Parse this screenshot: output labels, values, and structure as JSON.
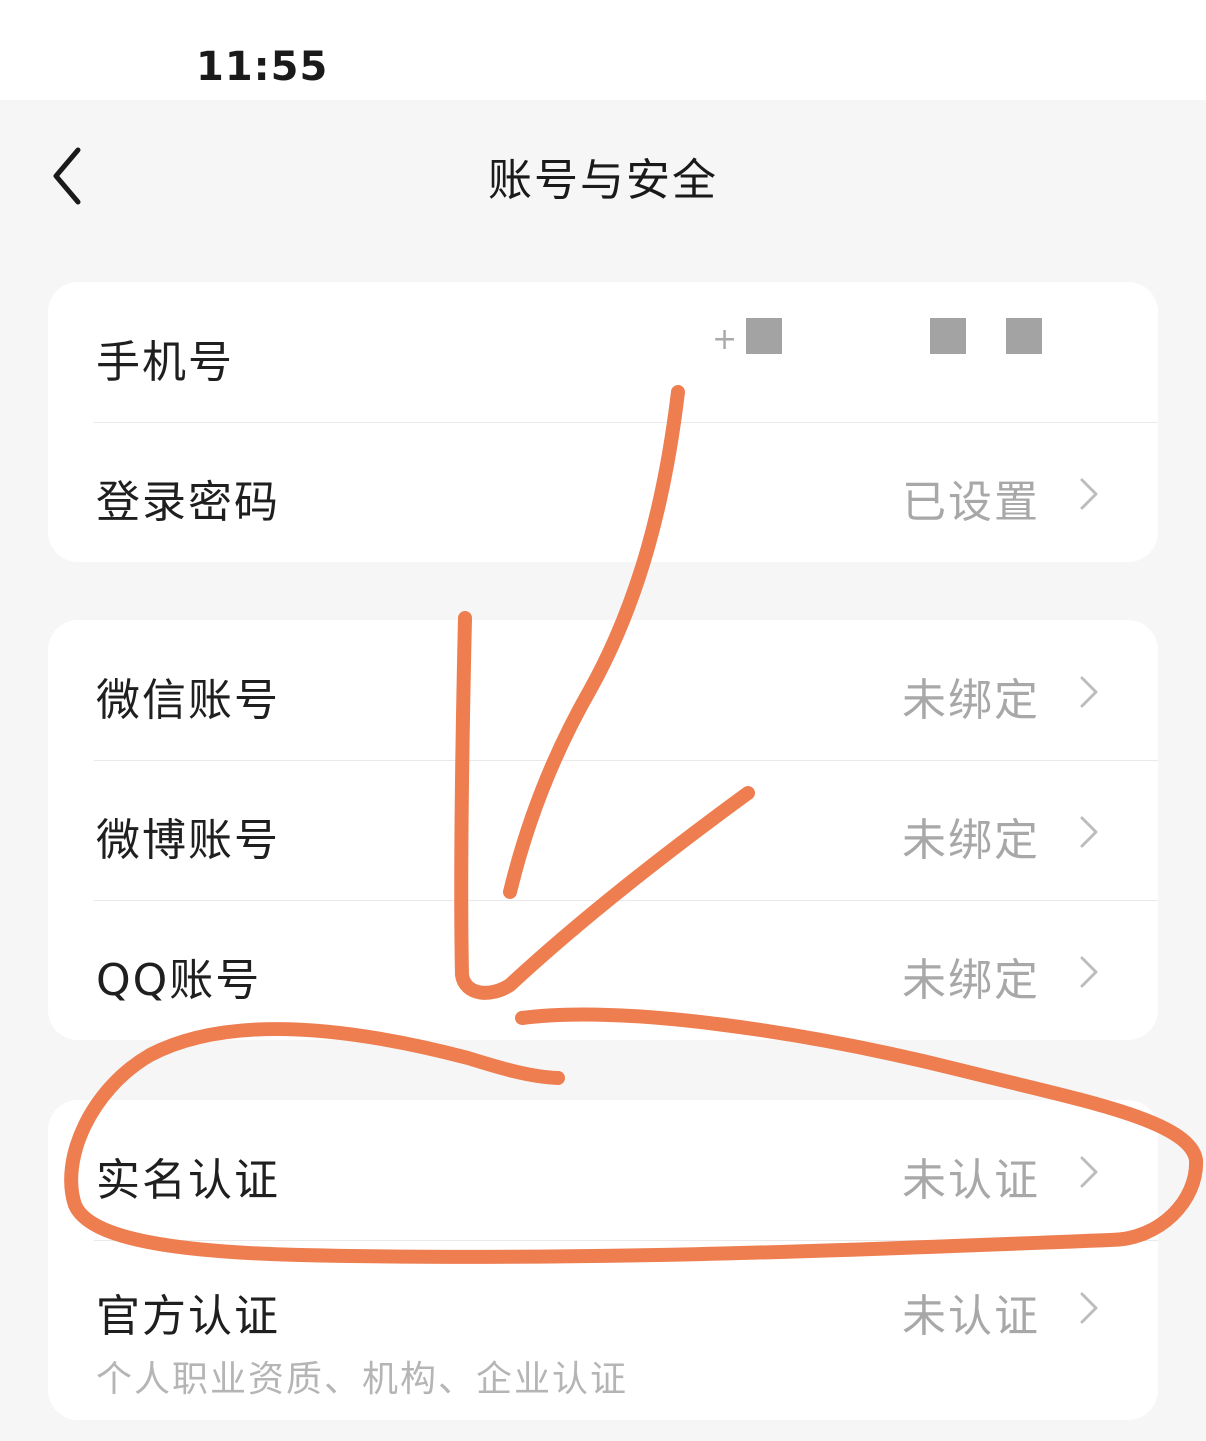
{
  "status_bar": {
    "time": "11:55"
  },
  "nav": {
    "title": "账号与安全",
    "back_icon": "chevron-left-icon"
  },
  "groups": [
    {
      "rows": [
        {
          "label": "手机号",
          "value": "+",
          "masked": true
        },
        {
          "label": "登录密码",
          "value": "已设置"
        }
      ]
    },
    {
      "rows": [
        {
          "label": "微信账号",
          "value": "未绑定"
        },
        {
          "label": "微博账号",
          "value": "未绑定"
        },
        {
          "label": "QQ账号",
          "value": "未绑定"
        }
      ]
    },
    {
      "rows": [
        {
          "label": "实名认证",
          "value": "未认证"
        },
        {
          "label": "官方认证",
          "value": "未认证",
          "subtitle": "个人职业资质、机构、企业认证"
        }
      ]
    }
  ],
  "colors": {
    "background": "#f6f6f6",
    "card": "#ffffff",
    "muted_text": "#a8a8a8",
    "annotation_stroke": "#ee7d50"
  },
  "icons": {
    "row_chevron": "chevron-right-icon"
  }
}
